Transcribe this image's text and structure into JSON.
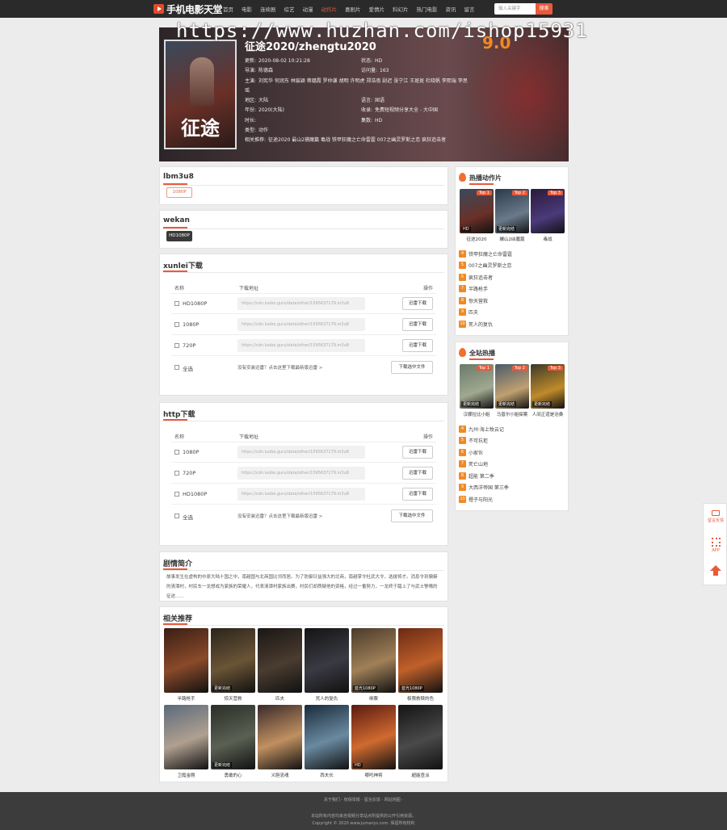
{
  "topbar": {
    "logo_text": "手机电影天堂",
    "nav": [
      "首页",
      "电影",
      "连续剧",
      "综艺",
      "动漫",
      "动作片",
      "喜剧片",
      "爱情片",
      "科幻片",
      "热门电影",
      "资讯",
      "留言"
    ],
    "active_index": 5,
    "search_placeholder": "输入关键字",
    "search_button": "搜索",
    "accent": "#e85a3a"
  },
  "watermark": "https://www.huzhan.com/ishop15931",
  "movie": {
    "title": "征途2020/zhengtu2020",
    "score": "9.0",
    "poster_text": "征途",
    "left": [
      {
        "label": "更新:",
        "value": "2020-08-02 10:21:28"
      },
      {
        "label": "导演:",
        "value": "陈德森"
      },
      {
        "label": "主演:",
        "value": "刘宪华 何润东 林宸颖 蒋璐霞 罗仲谦 胡明 许明虎 郑浩南 尉迟 张宁江 王斑斑 杜晓帆 李熙瑞 李思瑶"
      },
      {
        "label": "地区:",
        "value": "大陆"
      },
      {
        "label": "年份:",
        "value": "2020(大陆)"
      },
      {
        "label": "时长:",
        "value": ""
      },
      {
        "label": "类型:",
        "value": "动作"
      },
      {
        "label": "相关推荐:",
        "value": "征途2020 最山2捕魔篇 毒战 铁甲狂魔之亡命雷霆 007之幽灵罗斯之恋 疯狂追击者"
      }
    ],
    "right": [
      {
        "label": "状态:",
        "value": "HD"
      },
      {
        "label": "访问量:",
        "value": "163"
      },
      {
        "label": "语言:",
        "value": "国语"
      },
      {
        "label": "收录:",
        "value": "免费短视频分享大全 - 大中国"
      },
      {
        "label": "集数:",
        "value": "HD"
      }
    ]
  },
  "sources": [
    {
      "title": "lbm3u8",
      "tag": "1080P"
    },
    {
      "title": "wekan",
      "tag": "HD1080P"
    }
  ],
  "downloads": [
    {
      "title": "xunlei下载",
      "col_name": "名称",
      "col_url": "下载地址",
      "col_op": "操作",
      "rows": [
        {
          "name": "HD1080P",
          "url": "https://cdn.luobo.guru/data/other/1595637179.m3u8",
          "btn": "迅雷下载"
        },
        {
          "name": "1080P",
          "url": "https://cdn.luobo.guru/data/other/1595637179.m3u8",
          "btn": "迅雷下载"
        },
        {
          "name": "720P",
          "url": "https://cdn.luobo.guru/data/other/1595637179.m3u8",
          "btn": "迅雷下载"
        }
      ],
      "select_all": "全选",
      "note": "没有安装迅雷？点击这里下载最新版迅雷 >",
      "bulk_btn": "下载选中文件"
    },
    {
      "title": "http下载",
      "col_name": "名称",
      "col_url": "下载地址",
      "col_op": "操作",
      "rows": [
        {
          "name": "1080P",
          "url": "https://cdn.luobo.guru/data/other/1595637179.m3u8",
          "btn": "迅雷下载"
        },
        {
          "name": "720P",
          "url": "https://cdn.luobo.guru/data/other/1595637179.m3u8",
          "btn": "迅雷下载"
        },
        {
          "name": "HD1080P",
          "url": "https://cdn.luobo.guru/data/other/1595637179.m3u8",
          "btn": "迅雷下载"
        }
      ],
      "select_all": "全选",
      "note": "没有安装迅雷？点击这里下载最新版迅雷 >",
      "bulk_btn": "下载选中文件"
    }
  ],
  "synopsis": {
    "title": "剧情简介",
    "text": "故事发生在虚构的中原大陆十国之中，南越国与北商国比邻而居。为了防御日益强大的北商，南越掌令杜武大令，选拔将才。消息令到偏僻的清潭村，村民车一龙想成为家族的荣耀人，代表清潭村家族出赛，村民们却质疑他的资格，经过一番努力，一龙终于踏上了与武士警嘴的征途......"
  },
  "related": {
    "title": "相关推荐",
    "items": [
      {
        "name": "半路枪手",
        "badge": ""
      },
      {
        "name": "惊天营救",
        "badge": "更新完结"
      },
      {
        "name": "匹夫",
        "badge": ""
      },
      {
        "name": "死人的复仇",
        "badge": ""
      },
      {
        "name": "绑票",
        "badge": "蓝光1080P"
      },
      {
        "name": "极限救赎的色",
        "badge": "蓝光1080P"
      },
      {
        "name": "卫霞金刚",
        "badge": ""
      },
      {
        "name": "勇敢的心",
        "badge": "更新完结"
      },
      {
        "name": "义胆忠魂",
        "badge": ""
      },
      {
        "name": "西夫长",
        "badge": ""
      },
      {
        "name": "哪吒神将",
        "badge": "HD"
      },
      {
        "name": "超能查派",
        "badge": ""
      }
    ]
  },
  "hot_action": {
    "title": "热播动作片",
    "thumbs": [
      {
        "name": "征途2020",
        "top": "Top 1",
        "badge": "HD"
      },
      {
        "name": "螺山2凶魔篇",
        "top": "Top 2",
        "badge": "更新完结"
      },
      {
        "name": "毒战",
        "top": "Top 3",
        "badge": ""
      }
    ],
    "list": [
      {
        "n": "4",
        "name": "铁甲狂魔之亡命雷霆"
      },
      {
        "n": "5",
        "name": "007之幽灵罗斯之恋"
      },
      {
        "n": "6",
        "name": "疯狂追击者"
      },
      {
        "n": "7",
        "name": "半路枪手"
      },
      {
        "n": "8",
        "name": "惊天营救"
      },
      {
        "n": "9",
        "name": "匹夫"
      },
      {
        "n": "10",
        "name": "死人的复仇"
      }
    ]
  },
  "hot_site": {
    "title": "全站热播",
    "thumbs": [
      {
        "name": "汉娜拉比小姐",
        "top": "Top 1",
        "badge": "更新完结"
      },
      {
        "name": "马普尔小姐探案",
        "top": "Top 2",
        "badge": "更新完结"
      },
      {
        "name": "人间正道是沧桑",
        "top": "Top 3",
        "badge": "更新完结"
      }
    ],
    "list": [
      {
        "n": "4",
        "name": "九州·海上牧云记"
      },
      {
        "n": "5",
        "name": "不可抗拒"
      },
      {
        "n": "6",
        "name": "小家伙"
      },
      {
        "n": "7",
        "name": "死亡山地"
      },
      {
        "n": "8",
        "name": "超能 第二季"
      },
      {
        "n": "9",
        "name": "大西洋帝国 第三季"
      },
      {
        "n": "10",
        "name": "橙子与阳光"
      }
    ]
  },
  "floatbar": {
    "feedback": "留言反馈",
    "app": "APP"
  },
  "footer": {
    "links": "关于我们 - 权保举报 - 留言反馈 - 网站地图 -",
    "disclaimer": "本站所有内容均来自视频分享站点所提供的公开引用资源。",
    "copyright": "Copyright © 2020 www.jumanys.com. 保留所有权利"
  }
}
